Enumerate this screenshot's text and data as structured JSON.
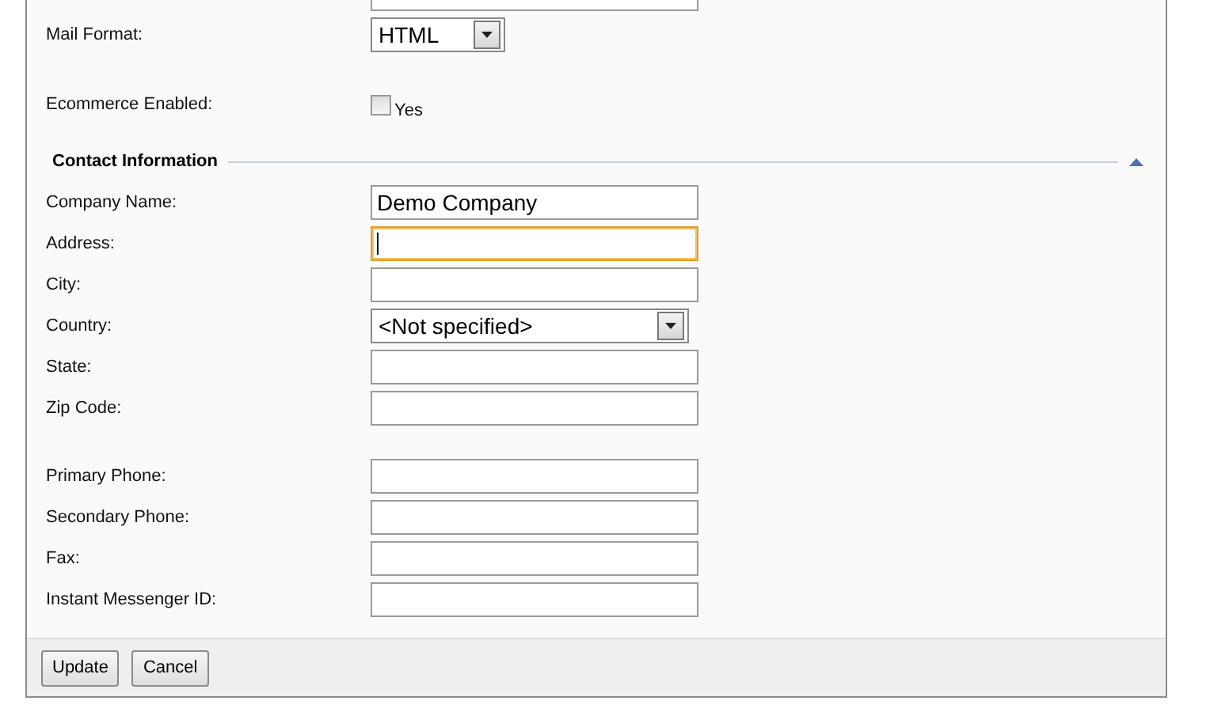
{
  "settings": [
    {
      "label": "Mail Format:",
      "kind": "select",
      "value": "HTML"
    },
    {
      "label": "Ecommerce Enabled:",
      "kind": "checkbox",
      "checked": false,
      "option": "Yes"
    }
  ],
  "contact": {
    "title": "Contact Information",
    "expanded": true,
    "field_groups": [
      [
        {
          "label": "Company Name:",
          "kind": "text",
          "value": "Demo Company",
          "focused": false
        },
        {
          "label": "Address:",
          "kind": "text",
          "focused": true
        },
        {
          "label": "City:",
          "kind": "text",
          "focused": false
        },
        {
          "label": "Country:",
          "kind": "select",
          "value": "<Not specified>"
        },
        {
          "label": "State:",
          "kind": "text",
          "focused": false
        },
        {
          "label": "Zip Code:",
          "kind": "text",
          "focused": false
        }
      ],
      [
        {
          "label": "Primary Phone:",
          "kind": "text",
          "focused": false
        },
        {
          "label": "Secondary Phone:",
          "kind": "text",
          "focused": false
        },
        {
          "label": "Fax:",
          "kind": "text",
          "focused": false
        },
        {
          "label": "Instant Messenger ID:",
          "kind": "text",
          "focused": false
        }
      ]
    ]
  },
  "buttons": [
    "Update",
    "Cancel"
  ]
}
